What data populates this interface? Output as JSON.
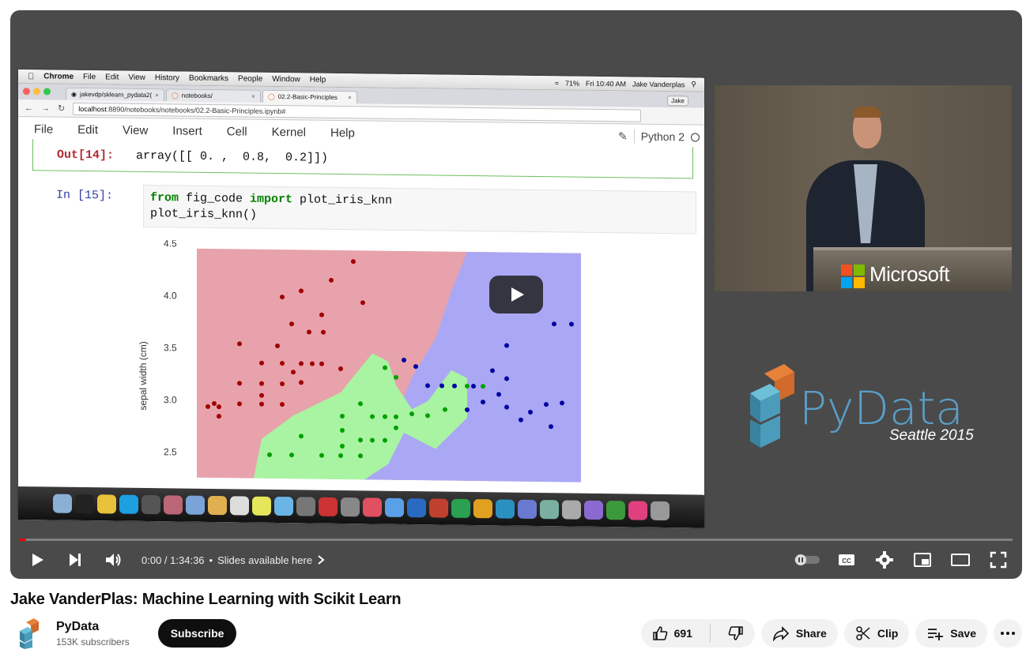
{
  "video": {
    "title": "Jake VanderPlas: Machine Learning with Scikit Learn",
    "time_current": "0:00",
    "time_total": "1:34:36",
    "chapter_label": "Slides available here",
    "progress_fraction": 0.0
  },
  "channel": {
    "name": "PyData",
    "subscribers": "153K subscribers",
    "subscribe_label": "Subscribe"
  },
  "actions": {
    "like_count": "691",
    "share_label": "Share",
    "clip_label": "Clip",
    "save_label": "Save"
  },
  "screen": {
    "mac_menu": [
      "Chrome",
      "File",
      "Edit",
      "View",
      "History",
      "Bookmarks",
      "People",
      "Window",
      "Help"
    ],
    "status_right": [
      "71%",
      "Fri 10:40 AM",
      "Jake Vanderplas"
    ],
    "tabs": [
      "jakevdp/sklearn_pydata2(",
      "notebooks/",
      "02.2-Basic-Principles"
    ],
    "user_chip": "Jake",
    "url_host": "localhost",
    "url_path": ":8890/notebooks/notebooks/02.2-Basic-Principles.ipynb#",
    "nb_menu": [
      "File",
      "Edit",
      "View",
      "Insert",
      "Cell",
      "Kernel",
      "Help"
    ],
    "kernel": "Python 2",
    "out_prompt": "Out[14]:",
    "out_text": "array([[ 0. ,  0.8,  0.2]])",
    "in_prompt": "In [15]:",
    "code_kw1": "from",
    "code_mod": " fig_code ",
    "code_kw2": "import",
    "code_name": " plot_iris_knn",
    "code_line2": "plot_iris_knn()",
    "plot_ylabel": "sepal width (cm)",
    "plot_yticks": [
      "4.5",
      "4.0",
      "3.5",
      "3.0",
      "2.5"
    ]
  },
  "slide": {
    "brand": "Microsoft",
    "pydata_word": "PyData",
    "pydata_sub": "Seattle 2015"
  },
  "colors": {
    "red_region": "#e8a2ab",
    "blue_region": "#aaa8f4",
    "green_region": "#a8f4a2",
    "red_point": "#a00000",
    "blue_point": "#0000a0",
    "green_point": "#00a000",
    "youtube_red": "#ff0000"
  }
}
